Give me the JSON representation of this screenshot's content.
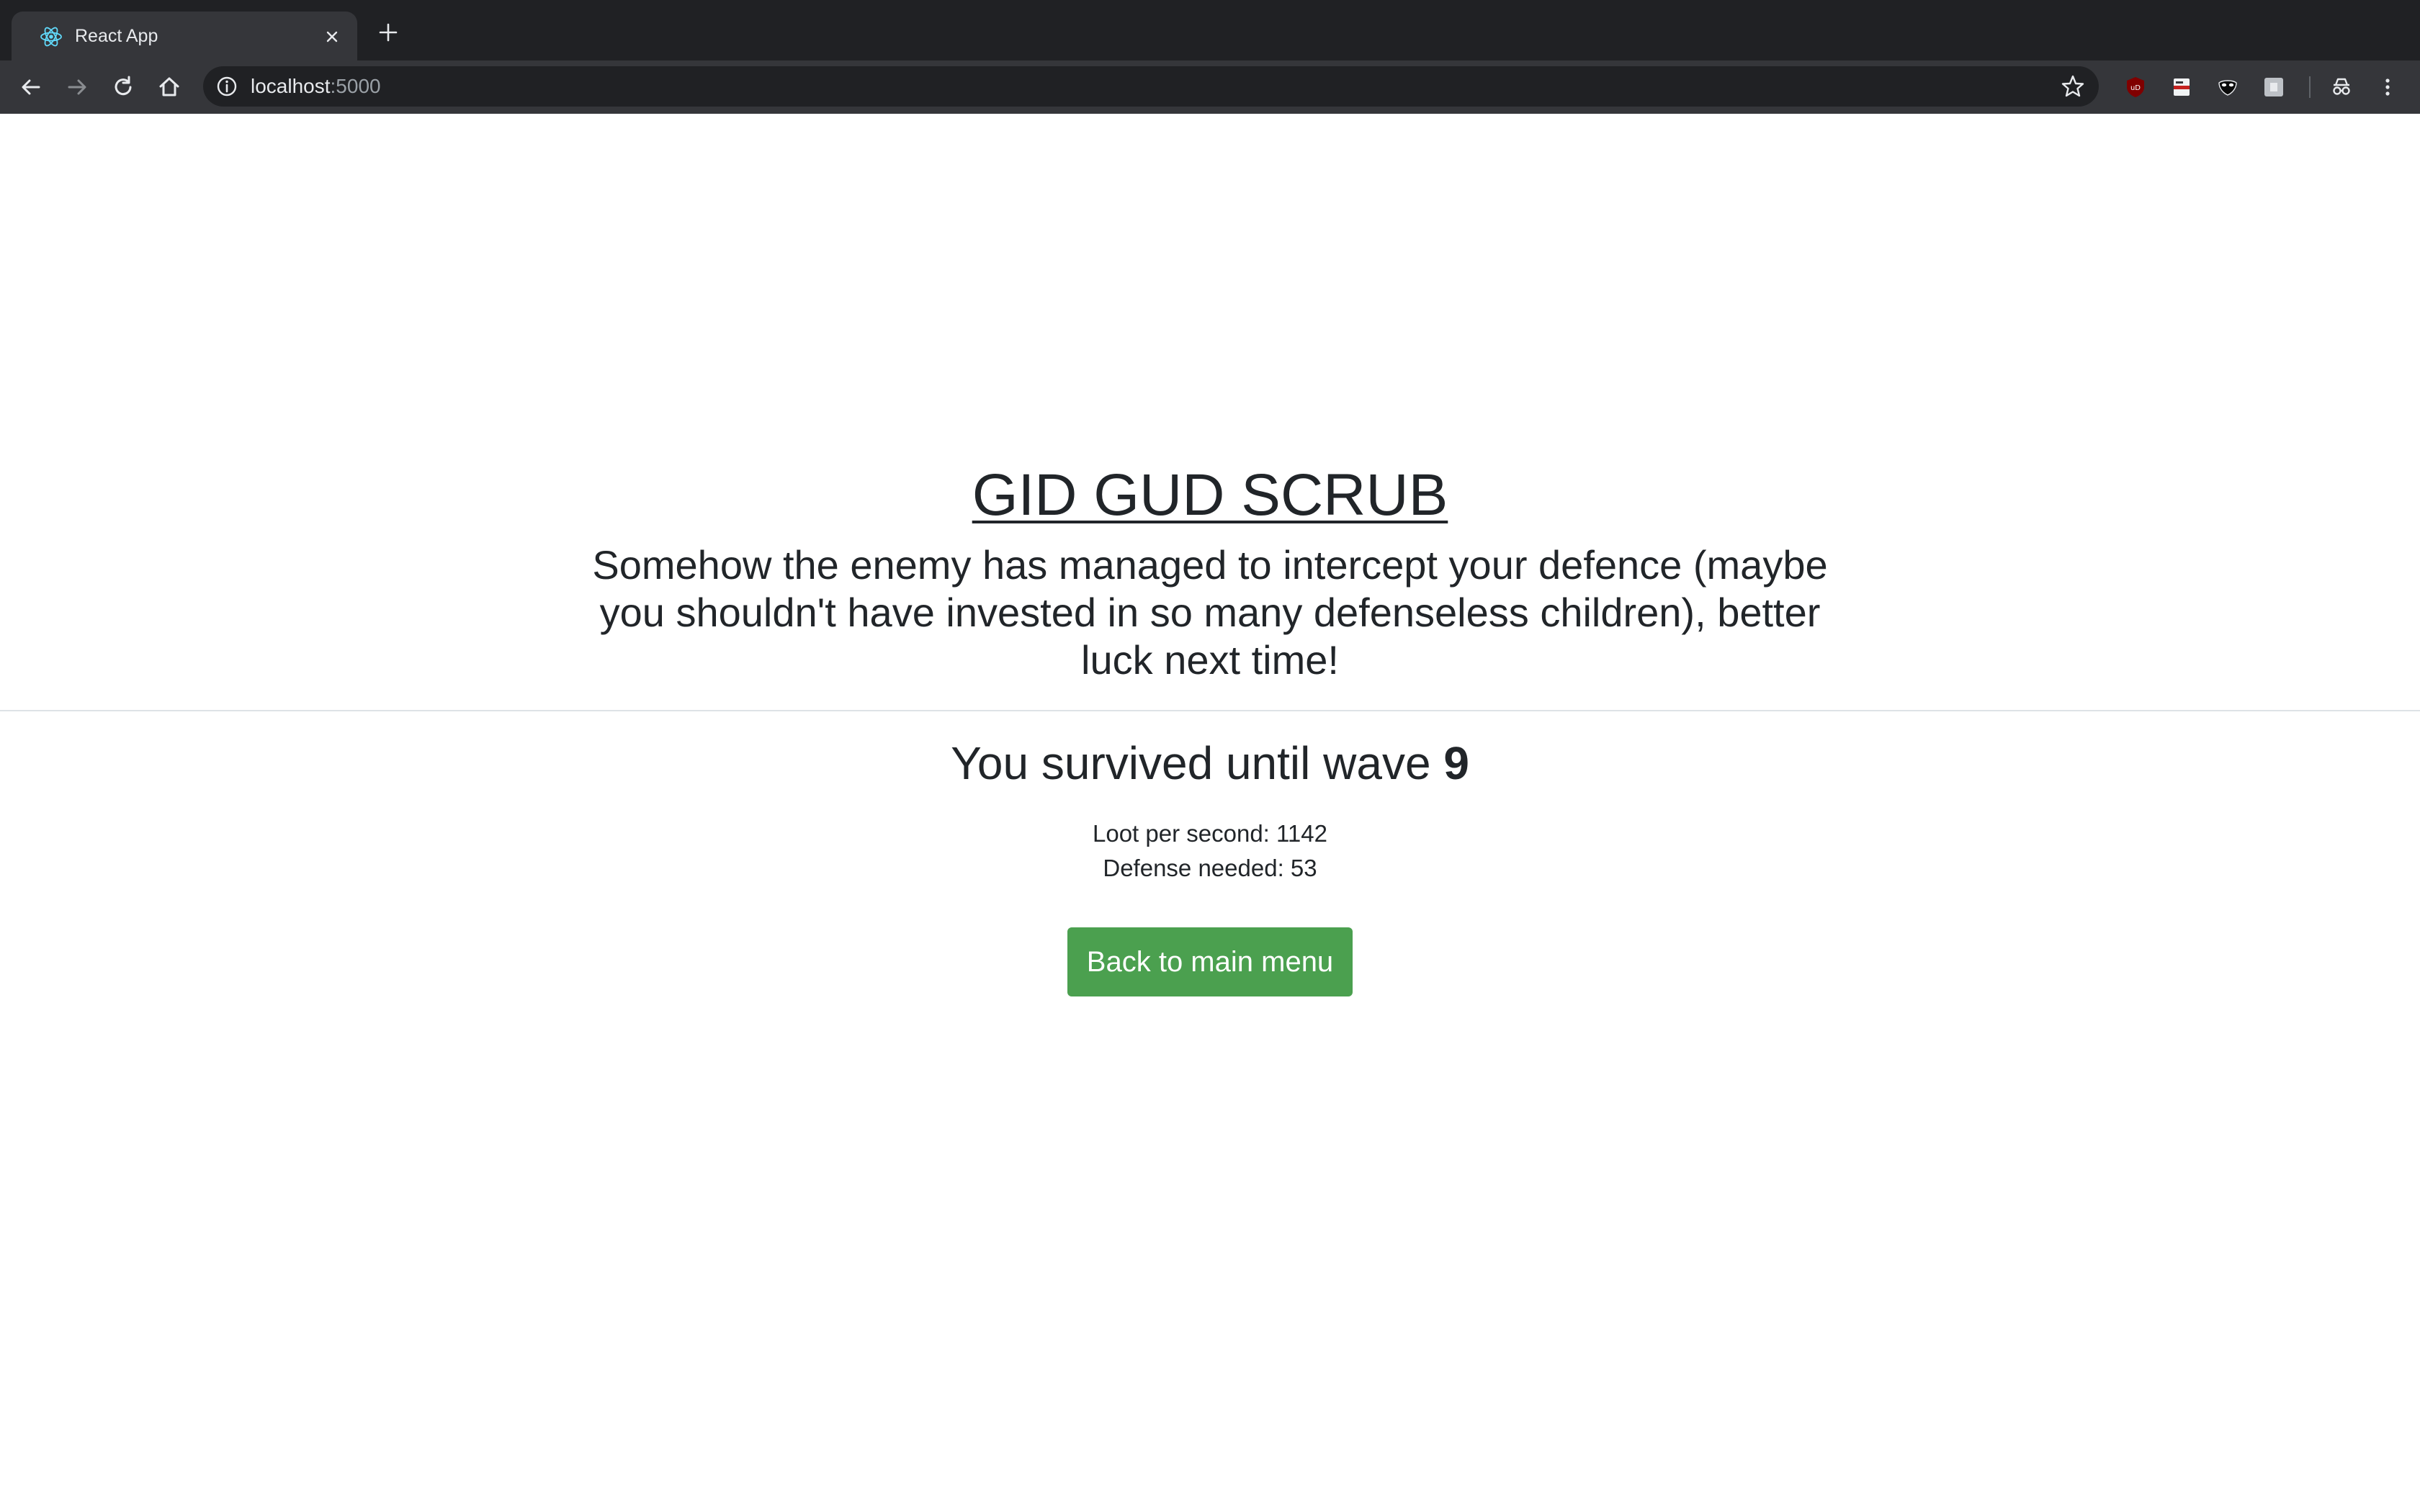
{
  "browser": {
    "tab_title": "React App",
    "url_host": "localhost",
    "url_port": ":5000",
    "icons": {
      "favicon": "react-logo-icon",
      "tab_close": "close-icon",
      "new_tab": "plus-icon",
      "back": "arrow-left-icon",
      "forward": "arrow-right-icon",
      "reload": "reload-icon",
      "home": "home-icon",
      "site_info": "info-icon",
      "bookmark": "star-icon",
      "extensions": [
        "ublock-icon",
        "extension-icon",
        "mask-icon",
        "puzzle-icon"
      ],
      "incognito": "incognito-icon",
      "menu": "kebab-menu-icon"
    },
    "colors": {
      "tabstrip": "#202124",
      "toolbar": "#35363a",
      "omnibox": "#202124"
    }
  },
  "game_over": {
    "headline": "GID GUD SCRUB",
    "message": "Somehow the enemy has managed to intercept your defence (maybe you shouldn't have invested in so many defenseless children), better luck next time!",
    "wave_prefix": "You survived until wave",
    "wave_number": "9",
    "loot_line": "Loot per second: 1142",
    "defense_line": "Defense needed: 53",
    "back_button_label": "Back to main menu",
    "colors": {
      "button": "#4ba04f",
      "text": "#212529"
    }
  }
}
